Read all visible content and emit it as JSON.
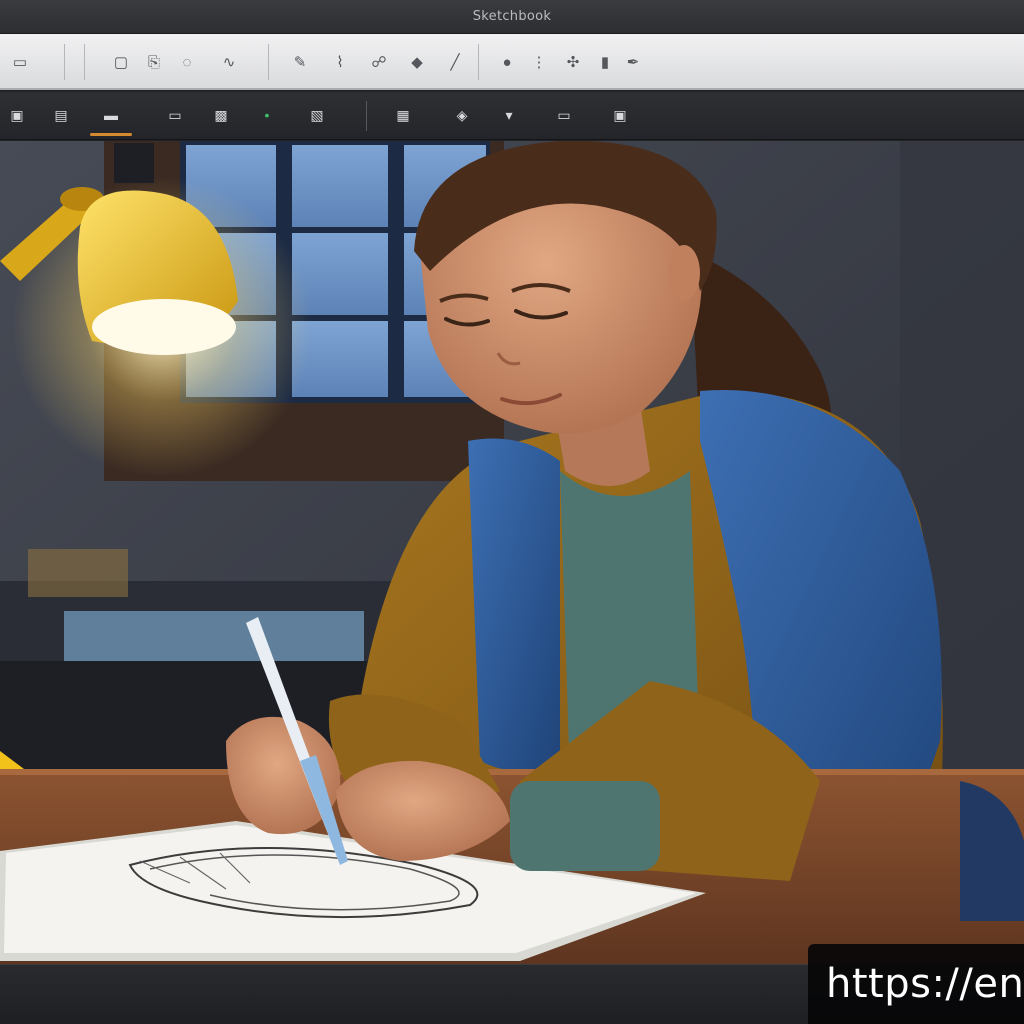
{
  "window": {
    "title": "Sketchbook"
  },
  "toolbar_primary": {
    "items": [
      {
        "name": "layout-icon",
        "glyph": "▭"
      },
      {
        "name": "new-icon",
        "glyph": "▢"
      },
      {
        "name": "save-icon",
        "glyph": "⎘"
      },
      {
        "name": "select-icon",
        "glyph": "◌"
      },
      {
        "name": "lasso-icon",
        "glyph": "∿"
      },
      {
        "name": "pencil-icon",
        "glyph": "✎"
      },
      {
        "name": "brush-icon",
        "glyph": "⌇"
      },
      {
        "name": "smudge-icon",
        "glyph": "☍"
      },
      {
        "name": "fill-icon",
        "glyph": "◆"
      },
      {
        "name": "line-icon",
        "glyph": "╱"
      },
      {
        "name": "color-icon",
        "glyph": "●"
      },
      {
        "name": "symmetry-icon",
        "glyph": "⋮"
      },
      {
        "name": "transform-icon",
        "glyph": "✣"
      },
      {
        "name": "eraser-icon",
        "glyph": "▮"
      },
      {
        "name": "pen-icon",
        "glyph": "✒"
      }
    ]
  },
  "toolbar_secondary": {
    "items": [
      {
        "name": "menu-icon",
        "glyph": "▣"
      },
      {
        "name": "layers-icon",
        "glyph": "▤"
      },
      {
        "name": "brush-preset-icon",
        "glyph": "▬"
      },
      {
        "name": "ruler-icon",
        "glyph": "▭"
      },
      {
        "name": "stencil-icon",
        "glyph": "▩"
      },
      {
        "name": "color-dot-icon",
        "glyph": "•"
      },
      {
        "name": "image-icon",
        "glyph": "▧"
      },
      {
        "name": "slider-icon",
        "glyph": "│"
      },
      {
        "name": "grid-icon",
        "glyph": "▦"
      },
      {
        "name": "fill-bucket-icon",
        "glyph": "◈"
      },
      {
        "name": "dropper-icon",
        "glyph": "▾"
      },
      {
        "name": "screen-icon",
        "glyph": "▭"
      },
      {
        "name": "camera-icon",
        "glyph": "▣"
      }
    ],
    "active": "brush-preset-icon"
  },
  "colors": {
    "accent": "#d58a2f",
    "lamp": "#f2c21b",
    "scarf": "#2c5a9a",
    "cardigan": "#9a6a1c",
    "window_glow": "#7fa6d6"
  },
  "watermark": {
    "text": "https://en-"
  }
}
